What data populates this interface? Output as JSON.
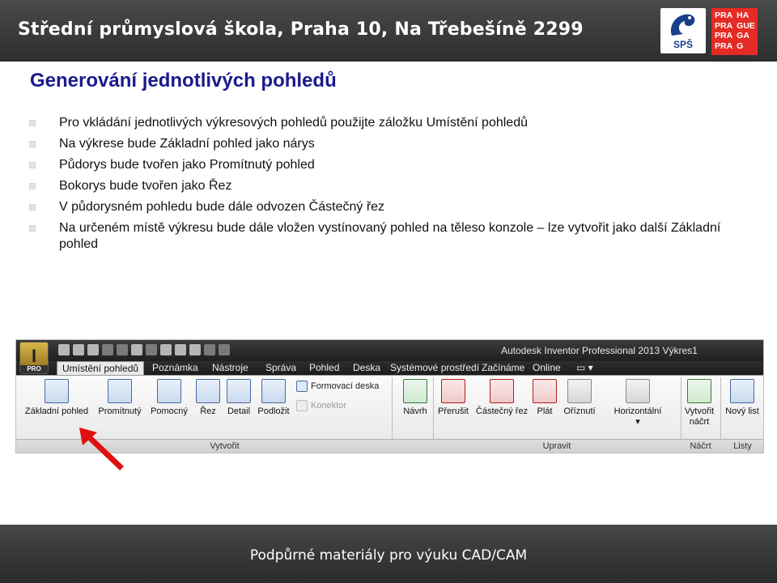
{
  "header": {
    "title": "Střední průmyslová škola, Praha 10, Na Třebešíně 2299",
    "logo_left_text": "SPŠ",
    "logo_right_rows": [
      [
        "PRA",
        "HA"
      ],
      [
        "PRA",
        "GUE"
      ],
      [
        "PRA",
        "GA"
      ],
      [
        "PRA",
        "G"
      ]
    ]
  },
  "slide": {
    "title": "Generování jednotlivých pohledů",
    "bullets": [
      "Pro vkládání jednotlivých výkresových pohledů použijte záložku Umístění pohledů",
      "Na výkrese bude Základní pohled jako nárys",
      "Půdorys bude tvořen jako Promítnutý pohled",
      "Bokorys bude tvořen jako Řez",
      "V půdorysném pohledu bude dále odvozen Částečný řez",
      "Na určeném místě výkresu bude dále vložen vystínovaný pohled na těleso konzole – lze vytvořit jako další Základní pohled"
    ]
  },
  "inventor": {
    "app_button_letter": "I",
    "app_button_sub": "PRO",
    "window_title": "Autodesk Inventor Professional 2013   Výkres1",
    "tabs": [
      "Umístění pohledů",
      "Poznámka",
      "Nástroje",
      "Správa",
      "Pohled",
      "Deska",
      "Systémové prostředí",
      "Začínáme",
      "Online"
    ],
    "create_buttons": [
      "Základní pohled",
      "Promítnutý",
      "Pomocný",
      "Řez",
      "Detail",
      "Podložit"
    ],
    "small_items": [
      "Formovací deska",
      "Konektor"
    ],
    "navrh": "Návrh",
    "modify_buttons": [
      "Přerušit",
      "Částečný řez",
      "Plát",
      "Oříznutí"
    ],
    "horizontal": "Horizontální",
    "sketch_button": [
      "Vytvořit",
      "náčrt"
    ],
    "sheet_button": "Nový list",
    "groups": [
      "Vytvořit",
      "Upravit",
      "Náčrt",
      "Listy"
    ]
  },
  "footer": {
    "text": "Podpůrné materiály pro výuku CAD/CAM"
  },
  "colors": {
    "title_blue": "#1a1a8e",
    "header_gray": "#3a3a3a",
    "arrow_red": "#e01010",
    "praha_red": "#e52b25"
  }
}
